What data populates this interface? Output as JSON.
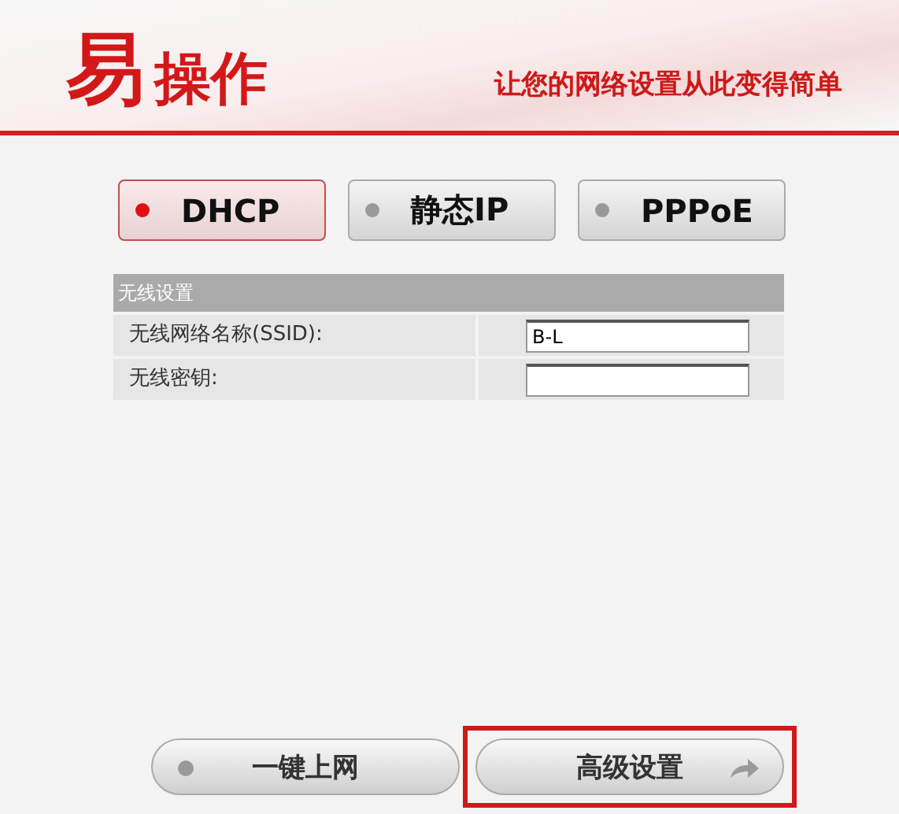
{
  "header": {
    "logo_big": "易",
    "logo_rest": "操作",
    "slogan": "让您的网络设置从此变得简单"
  },
  "modes": [
    {
      "label": "DHCP",
      "selected": true
    },
    {
      "label": "静态IP",
      "selected": false
    },
    {
      "label": "PPPoE",
      "selected": false
    }
  ],
  "wireless": {
    "title": "无线设置",
    "fields": [
      {
        "label": "无线网络名称(SSID):",
        "value": "B-L"
      },
      {
        "label": "无线密钥:"
      }
    ]
  },
  "actions": [
    {
      "label": "一键上网",
      "kind": "dot",
      "highlighted": false
    },
    {
      "label": "高级设置",
      "kind": "arrow",
      "highlighted": true
    }
  ]
}
